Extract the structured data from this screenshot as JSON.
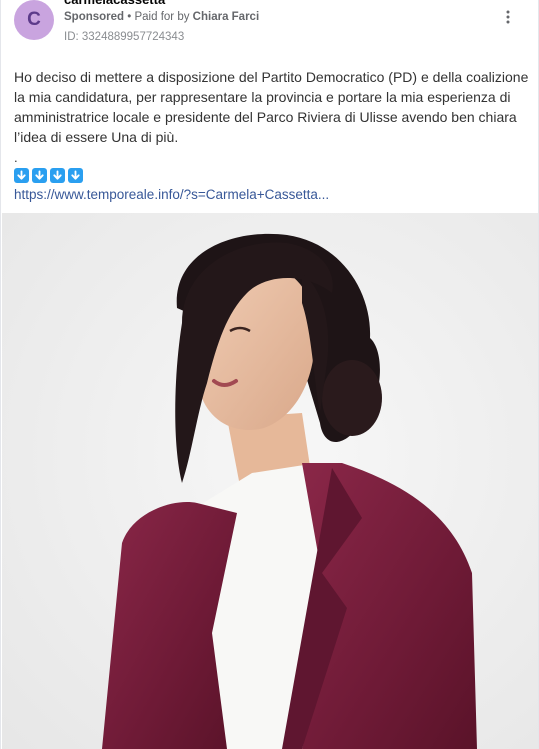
{
  "ad": {
    "page_name": "carmelacassetta",
    "avatar_letter": "C",
    "sponsored": "Sponsored",
    "paid_prefix": "• Paid for by",
    "paid_by": "Chiara Farci",
    "id_text": "ID: 3324889957724343"
  },
  "post": {
    "body": "Ho deciso di mettere a disposizione del Partito Democratico (PD) e della coalizione la mia candidatura, per rappresentare la provincia e portare la mia esperienza di amministratrice locale e presidente del Parco Riviera di Ulisse avendo ben chiara l’idea di essere Una di più.",
    "dot": ".",
    "arrow_emojis": [
      "down-arrow",
      "down-arrow",
      "down-arrow",
      "down-arrow"
    ],
    "link": "https://www.temporeale.info/?s=Carmela+Cassetta..."
  },
  "colors": {
    "avatar_bg": "#c9a4df",
    "link": "#385898",
    "arrow_emoji_bg": "#2a9ff0",
    "jacket": "#7a1f3d"
  },
  "icons": {
    "menu": "more-vertical-icon"
  }
}
